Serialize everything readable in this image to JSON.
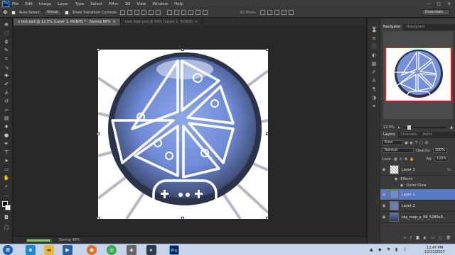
{
  "menubar": {
    "app_icon": "Ps",
    "items": [
      "File",
      "Edit",
      "Image",
      "Layer",
      "Type",
      "Select",
      "Filter",
      "3D",
      "View",
      "Window",
      "Help"
    ],
    "window_buttons": [
      "—",
      "□",
      "✕"
    ]
  },
  "options": {
    "auto_select_label": "Auto-Select:",
    "auto_select_value": "Group",
    "transform_label": "Show Transform Controls",
    "mode_3d_label": "3D Mode:",
    "workspace": "Essentials"
  },
  "tabs": [
    {
      "label": "x test.psd @ 12.5% (Layer 1, RGB/8) * - Saving 98%",
      "close": "×"
    },
    {
      "label": "new logo.psd @ 50% (Layer 1, RGB/8)",
      "close": "×"
    }
  ],
  "status": {
    "saving_label": "Saving 98%",
    "progress_pct": 98
  },
  "navigator": {
    "tabs": [
      "Navigator",
      "Histogram"
    ],
    "zoom": "12.5%"
  },
  "layers_panel": {
    "tabs": [
      "Layers",
      "Channels",
      "Paths"
    ],
    "kind_label": "Kind",
    "blend_mode": "Normal",
    "opacity_label": "Opacity:",
    "opacity_value": "100%",
    "lock_label": "Lock:",
    "fill_label": "Fill:",
    "fill_value": "100%",
    "layers": [
      {
        "name": "Layer 3",
        "fx": "fx"
      },
      {
        "name": "Effects"
      },
      {
        "name": "Outer Glow"
      },
      {
        "name": "Layer 1"
      },
      {
        "name": "Layer 2"
      },
      {
        "name": "sky_map_p_06_5280x3..."
      }
    ]
  },
  "taskbar": {
    "time": "12:47 PM",
    "date": "11/11/2017"
  },
  "colors": {
    "selected_layer": "#587ac4",
    "progress_fill": "#7cbf5f",
    "navigator_frame": "#ff2020",
    "taskbar": "#c5d4e8"
  }
}
